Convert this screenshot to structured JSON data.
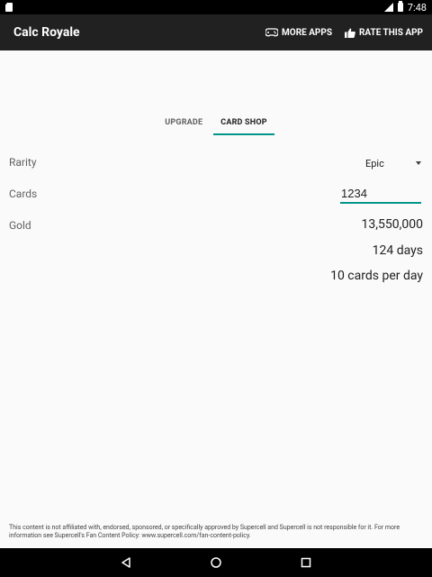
{
  "status_bar": {
    "time": "7:48"
  },
  "app_bar": {
    "title": "Calc Royale",
    "more_apps_label": "MORE APPS",
    "rate_label": "RATE THIS APP"
  },
  "tabs": [
    {
      "label": "UPGRADE",
      "active": false
    },
    {
      "label": "CARD SHOP",
      "active": true
    }
  ],
  "form": {
    "rarity_label": "Rarity",
    "rarity_value": "Epic",
    "cards_label": "Cards",
    "cards_value": "1234",
    "gold_label": "Gold",
    "gold_value": "13,550,000",
    "days_value": "124 days",
    "rate_value": "10 cards per day"
  },
  "disclaimer": "This content is not affiliated with, endorsed, sponsored, or specifically approved by Supercell and Supercell is not responsible for it. For more information see Supercell's Fan Content Policy: www.supercell.com/fan-content-policy.",
  "colors": {
    "accent": "#009688",
    "appbar": "#212121",
    "background": "#fafafa"
  },
  "icons": {
    "more_apps": "gamepad-icon",
    "rate": "thumbs-up-icon"
  }
}
